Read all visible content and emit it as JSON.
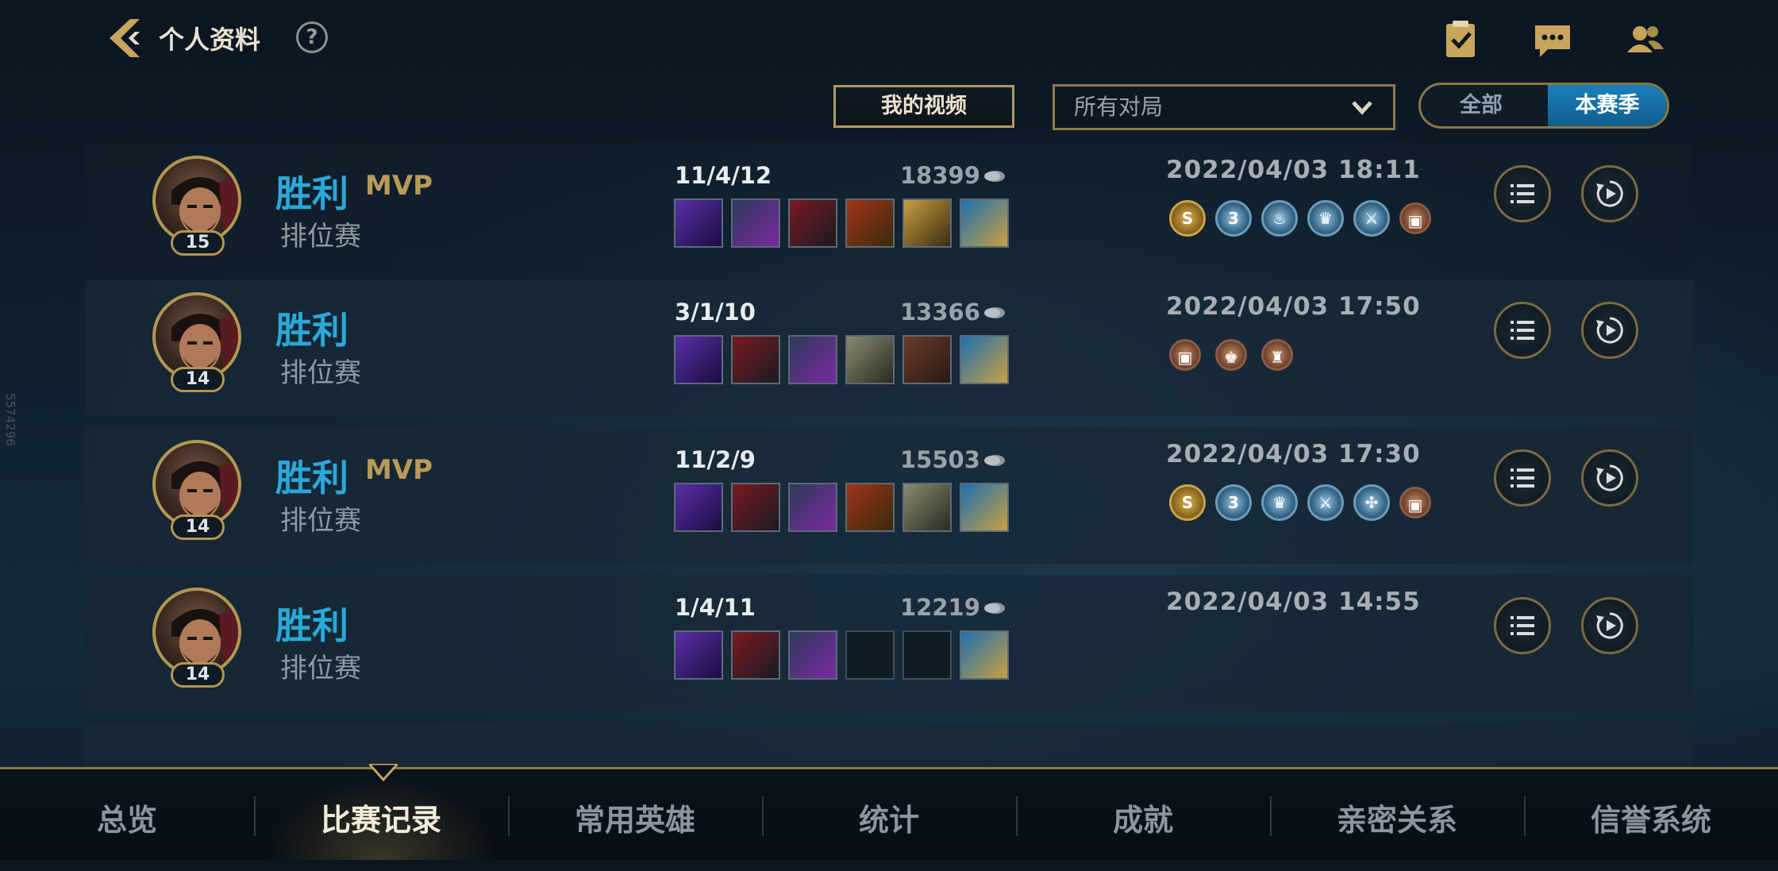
{
  "header": {
    "title": "个人资料",
    "help_label": "?"
  },
  "filters": {
    "video_button": "我的视频",
    "match_type": "所有对局",
    "toggle_all": "全部",
    "toggle_season": "本赛季"
  },
  "matches": [
    {
      "result": "胜利",
      "mvp": "MVP",
      "mode": "排位赛",
      "level": "15",
      "kda": "11/4/12",
      "gold": "18399",
      "date": "2022/04/03 18:11"
    },
    {
      "result": "胜利",
      "mvp": "",
      "mode": "排位赛",
      "level": "14",
      "kda": "3/1/10",
      "gold": "13366",
      "date": "2022/04/03 17:50"
    },
    {
      "result": "胜利",
      "mvp": "MVP",
      "mode": "排位赛",
      "level": "14",
      "kda": "11/2/9",
      "gold": "15503",
      "date": "2022/04/03 17:30"
    },
    {
      "result": "胜利",
      "mvp": "",
      "mode": "排位赛",
      "level": "14",
      "kda": "1/4/11",
      "gold": "12219",
      "date": "2022/04/03 14:55"
    }
  ],
  "bottom_nav": [
    "总览",
    "比赛记录",
    "常用英雄",
    "统计",
    "成就",
    "亲密关系",
    "信誉系统"
  ],
  "side_id": "5574296",
  "colors": {
    "victory": "#2aa8d8",
    "mvp": "#b99a56",
    "accent_gold": "#b19a5f",
    "active_toggle": "#1c80bd"
  }
}
